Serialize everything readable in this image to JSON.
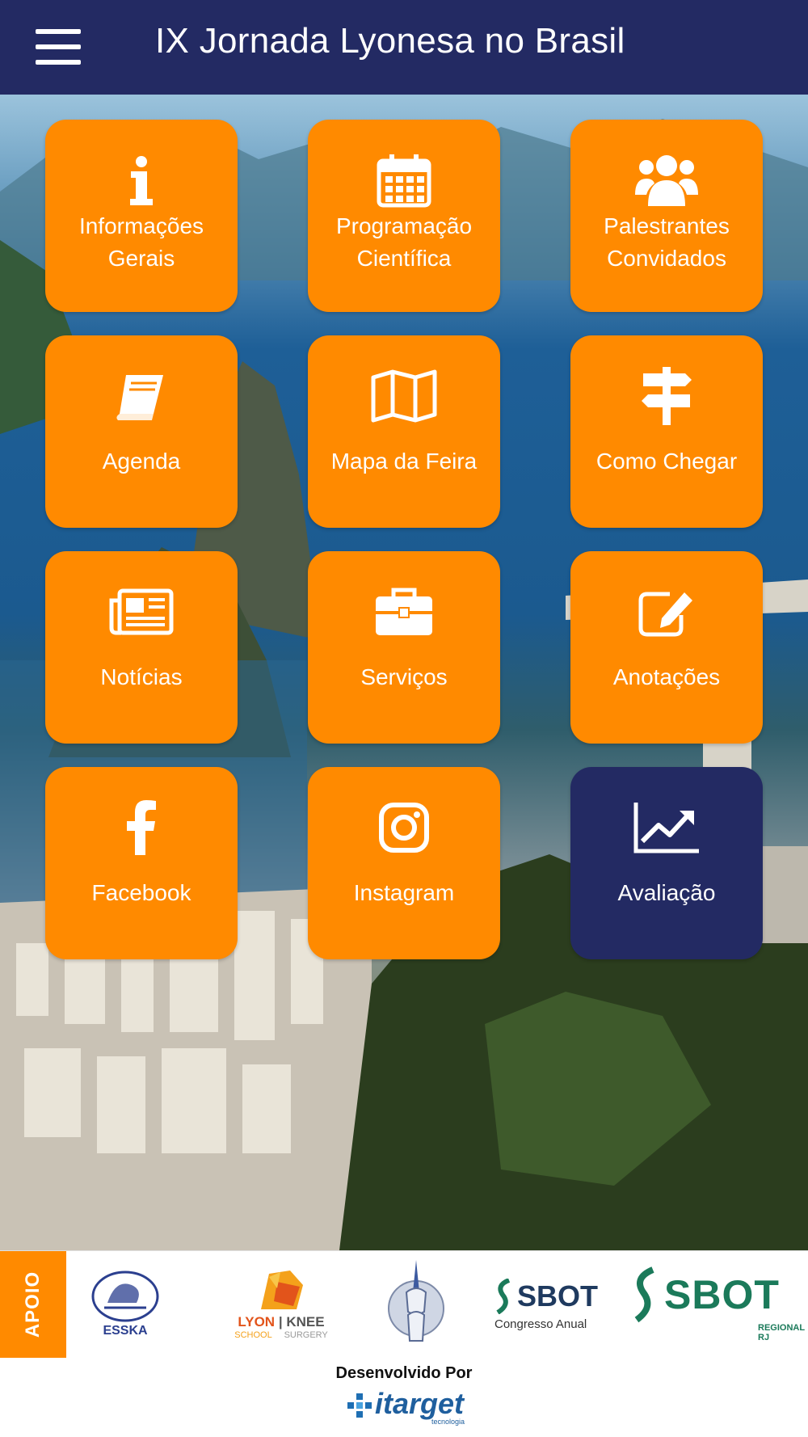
{
  "header": {
    "title": "IX Jornada Lyonesa no Brasil"
  },
  "tiles": [
    {
      "label": "Informações Gerais",
      "icon": "info-icon"
    },
    {
      "label": "Programação Científica",
      "icon": "calendar-icon"
    },
    {
      "label": "Palestrantes Convidados",
      "icon": "users-icon"
    },
    {
      "label": "Agenda",
      "icon": "book-icon"
    },
    {
      "label": "Mapa da Feira",
      "icon": "map-icon"
    },
    {
      "label": "Como Chegar",
      "icon": "signpost-icon"
    },
    {
      "label": "Notícias",
      "icon": "newspaper-icon"
    },
    {
      "label": "Serviços",
      "icon": "briefcase-icon"
    },
    {
      "label": "Anotações",
      "icon": "edit-icon"
    },
    {
      "label": "Facebook",
      "icon": "facebook-icon"
    },
    {
      "label": "Instagram",
      "icon": "instagram-icon"
    },
    {
      "label": "Avaliação",
      "icon": "chart-line-icon"
    }
  ],
  "apoio": {
    "label": "APOIO",
    "logos": {
      "essika": "ESSKA",
      "lyon_left": "LYON",
      "lyon_school": "SCHOOL",
      "lyon_knee": "KNEE",
      "lyon_surgery": "SURGERY",
      "sbot1": "SBOT",
      "sbot1_sub": "Congresso Anual",
      "sbot2": "SBOT",
      "sbot2_sub": "REGIONAL RJ"
    }
  },
  "footer": {
    "developed_by": "Desenvolvido Por",
    "brand": "itarget",
    "brand_sub": "tecnologia"
  },
  "colors": {
    "header": "#232a63",
    "tile": "#ff8a00",
    "tile_dark": "#232a63",
    "apoio_tab": "#ff8a00"
  }
}
